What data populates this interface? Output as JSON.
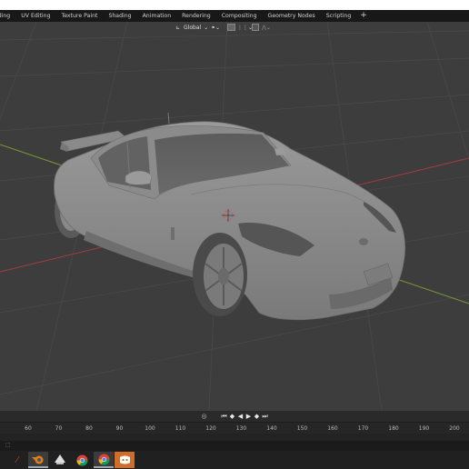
{
  "workspace_tabs": [
    "lding",
    "UV Editing",
    "Texture Paint",
    "Shading",
    "Animation",
    "Rendering",
    "Compositing",
    "Geometry Nodes",
    "Scripting",
    "+"
  ],
  "viewport_header": {
    "orientation": "Global"
  },
  "timeline": {
    "ticks": [
      "60",
      "70",
      "80",
      "90",
      "100",
      "110",
      "120",
      "130",
      "140",
      "150",
      "160",
      "170",
      "180",
      "190",
      "200"
    ]
  },
  "taskbar": {
    "icons": [
      "blender-icon",
      "inkscape-icon",
      "chrome-icon",
      "chrome-icon",
      "discord-icon"
    ]
  },
  "colors": {
    "viewport_bg": "#3d3d3d",
    "grid_line": "#4a4a4a",
    "x_axis": "#a13d3d",
    "y_axis": "#7a9a33",
    "model": "#8d8d8d",
    "discord": "#d06d28"
  }
}
